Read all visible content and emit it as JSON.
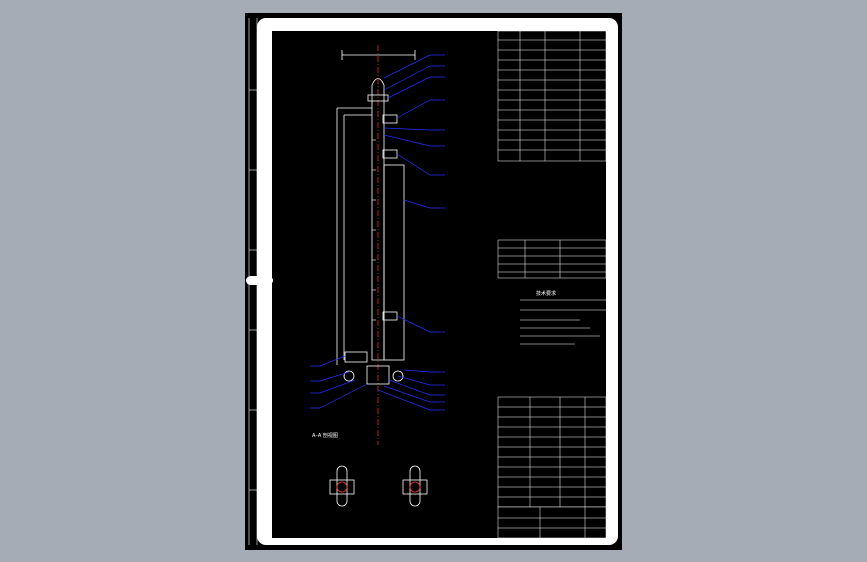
{
  "viewer": {
    "background": "#a6acb5",
    "sheet_color": "#000000",
    "paper_color": "#ffffff"
  },
  "drawing": {
    "section_label": "A–A 剖视图",
    "notes_title": "技术要求",
    "centerline_color": "#ff3030",
    "leader_color": "#2030ff",
    "line_color": "#ffffff"
  }
}
